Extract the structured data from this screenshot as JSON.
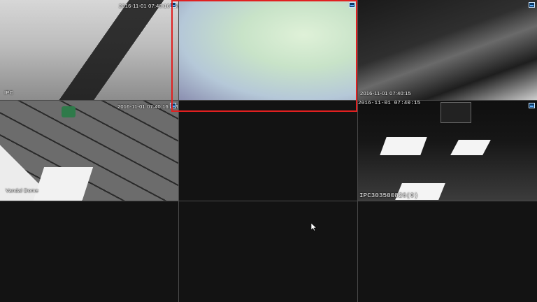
{
  "window": {
    "title": ""
  },
  "layout": {
    "grid": "3x3"
  },
  "selection_color": "#e02020",
  "tiles": [
    {
      "id": 1,
      "timestamp": "2016-11-01 07:40:16 AM",
      "label": "IPC",
      "status": "live",
      "icon": "camera-icon"
    },
    {
      "id": 2,
      "timestamp": "",
      "label": "",
      "status": "live",
      "selected": true,
      "icon": "camera-icon"
    },
    {
      "id": 3,
      "timestamp": "2016-11-01 07:40:15",
      "label": "",
      "status": "live",
      "icon": "camera-icon"
    },
    {
      "id": 4,
      "timestamp": "2016-11-01 07:40:16 AM",
      "label": "Vandal Dome",
      "status": "live",
      "icon": "camera-icon"
    },
    {
      "id": 5,
      "timestamp": "",
      "label": "",
      "status": "empty"
    },
    {
      "id": 6,
      "timestamp": "2016-11-01 07:40:15",
      "label": "IPC303500826(0)",
      "status": "live",
      "icon": "camera-icon"
    },
    {
      "id": 7,
      "timestamp": "",
      "label": "",
      "status": "empty"
    },
    {
      "id": 8,
      "timestamp": "",
      "label": "",
      "status": "empty"
    },
    {
      "id": 9,
      "timestamp": "",
      "label": "",
      "status": "empty"
    }
  ],
  "cursor_icon": "mouse-pointer-icon"
}
